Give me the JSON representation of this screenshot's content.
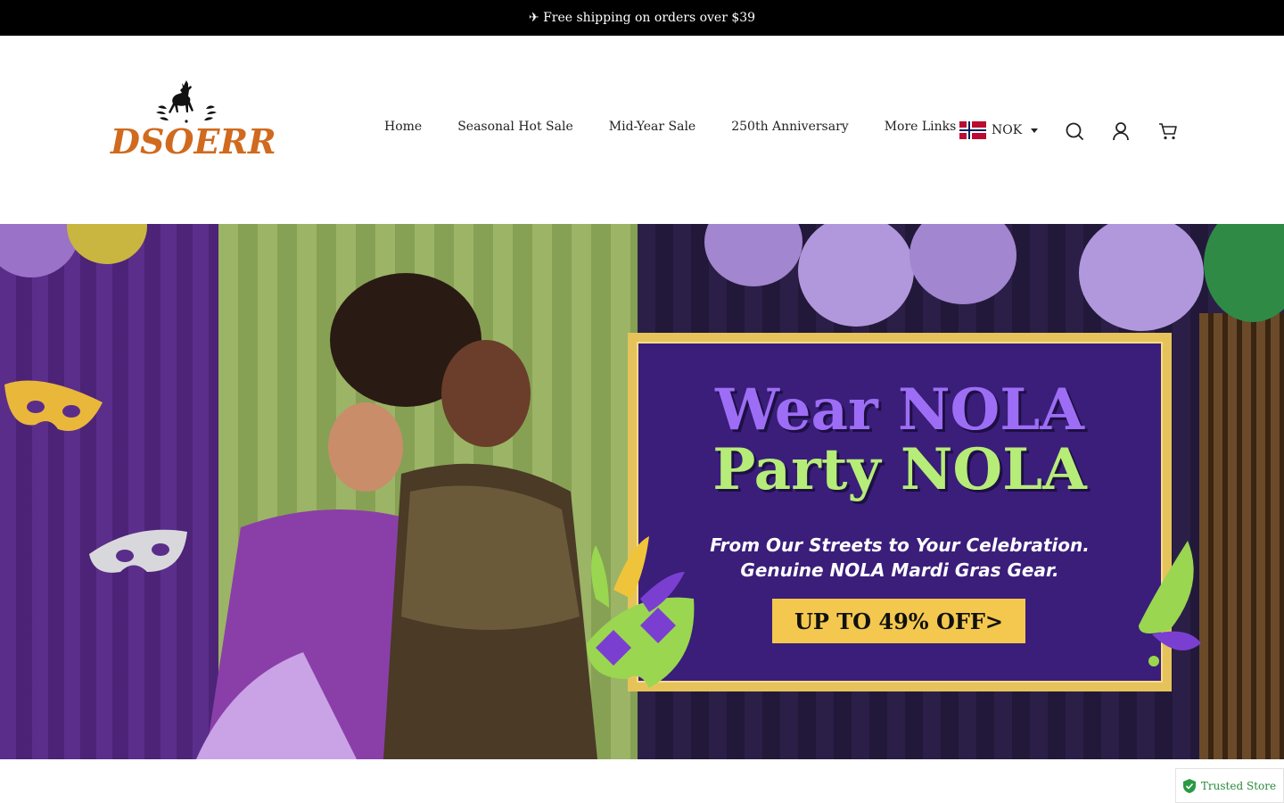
{
  "announcement": {
    "text": "✈ Free shipping on orders over $39"
  },
  "header": {
    "logo_text": "DSOERR",
    "nav": [
      {
        "label": "Home"
      },
      {
        "label": "Seasonal Hot Sale"
      },
      {
        "label": "Mid-Year Sale"
      },
      {
        "label": "250th Anniversary"
      },
      {
        "label": "More Links"
      }
    ],
    "currency": {
      "code": "NOK",
      "flag_icon": "norway-flag-icon"
    },
    "icons": [
      "search-icon",
      "account-icon",
      "cart-icon"
    ]
  },
  "hero": {
    "headline_line1": "Wear NOLA",
    "headline_line2": "Party NOLA",
    "subtitle_line1": "From Our Streets to Your Celebration.",
    "subtitle_line2": "Genuine NOLA Mardi Gras Gear.",
    "cta_label": "UP TO 49% OFF>",
    "colors": {
      "panel": "#3a1e7a",
      "gold": "#e6c35a",
      "purple_text": "#9d6ef5",
      "green_text": "#b6ec78",
      "cta": "#f4c84e"
    }
  },
  "badge": {
    "label": "Trusted Store",
    "icon": "shield-check-icon"
  },
  "colors": {
    "brand_orange": "#d06a1e",
    "announcement_bg": "#000000"
  }
}
